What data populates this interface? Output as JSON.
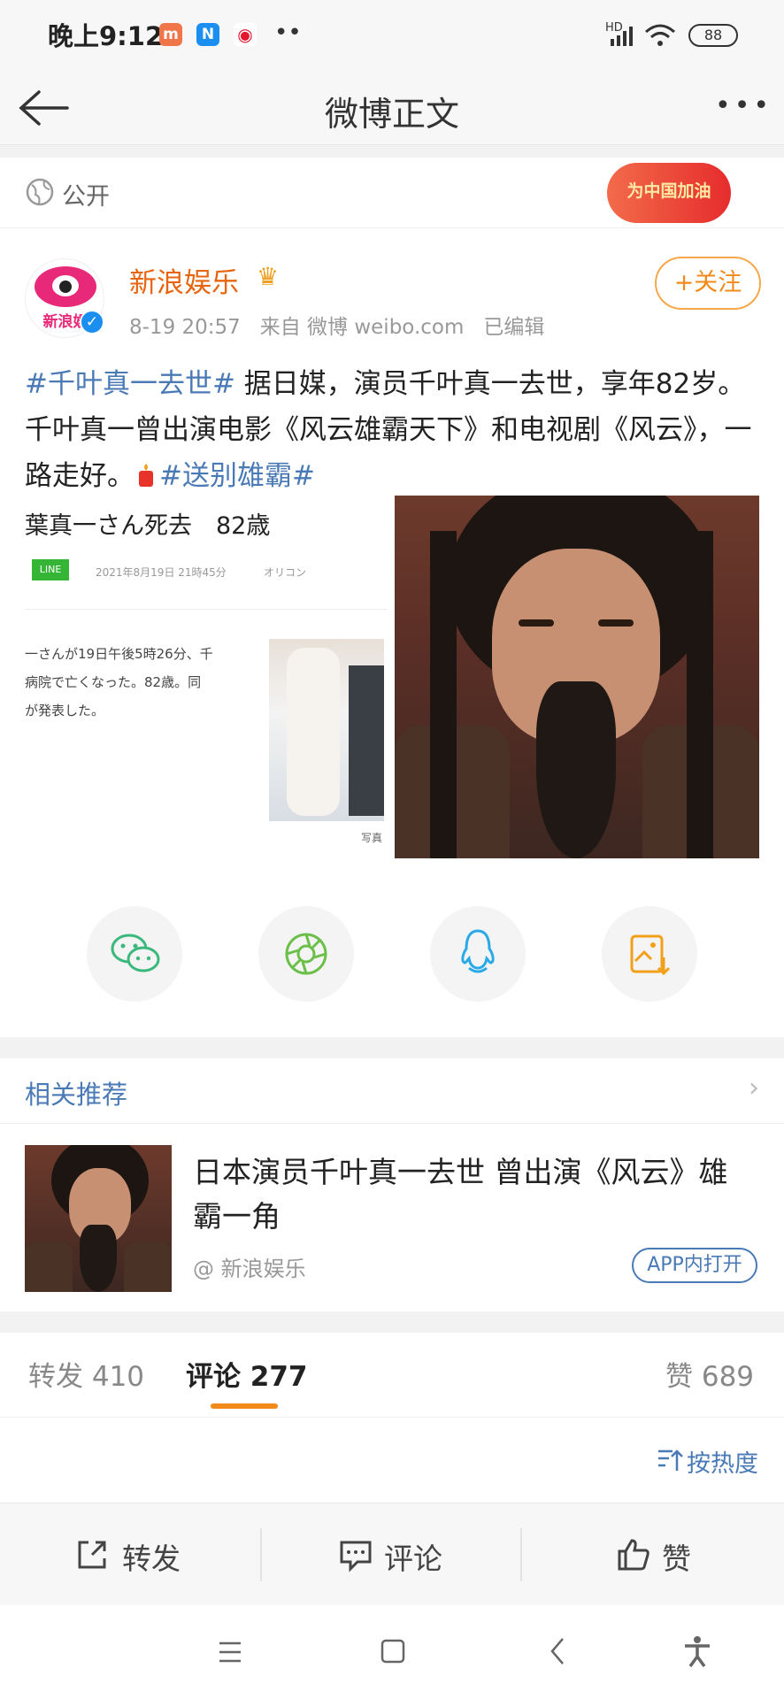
{
  "status": {
    "time": "晚上9:12",
    "battery": "88",
    "network": "HD"
  },
  "nav": {
    "title": "微博正文"
  },
  "visibility": {
    "label": "公开",
    "badge": "为中国加油"
  },
  "post": {
    "author": "新浪娱乐",
    "avatar_text": "新浪娱",
    "meta": "8-19 20:57   来自 微博 weibo.com   已编辑",
    "follow_label": "+关注",
    "tag1": "#千叶真一去世#",
    "text": " 据日媒，演员千叶真一去世，享年82岁。千叶真一曾出演电影《风云雄霸天下》和电视剧《风云》，一路走好。",
    "tag2": "#送别雄霸#",
    "image_text": {
      "headline": "葉真一さん死去　82歳",
      "date": "2021年8月19日 21時45分",
      "source": "オリコン",
      "body1": "一さんが19日午後5時26分、千",
      "body2": "病院で亡くなった。82歳。同",
      "body3": "が発表した。",
      "caption": "写真",
      "chip": "LINE"
    }
  },
  "recommend": {
    "header": "相关推荐",
    "title": "日本演员千叶真一去世 曾出演《风云》雄霸一角",
    "source": "@ 新浪娱乐",
    "open_label": "APP内打开"
  },
  "tabs": {
    "repost_label": "转发",
    "repost_count": "410",
    "comment_label": "评论",
    "comment_count": "277",
    "like_label": "赞",
    "like_count": "689"
  },
  "sort": {
    "label": "按热度"
  },
  "actions": {
    "repost": "转发",
    "comment": "评论",
    "like": "赞"
  },
  "colors": {
    "accent": "#f28a1a",
    "link": "#4a7ab6",
    "orange_underline": "#f28a1a"
  }
}
